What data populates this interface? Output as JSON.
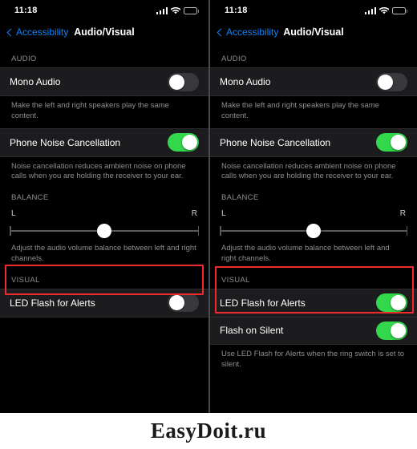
{
  "watermark": {
    "text": "EasyDoit.ru"
  },
  "colors": {
    "accent_blue": "#0a84ff",
    "toggle_on_green": "#32d74b",
    "highlight_red": "#ef2b2b",
    "group_bg": "#1c1c1e",
    "screen_bg": "#000000",
    "secondary_text": "#8e8e93"
  },
  "status_bar": {
    "time": "11:18",
    "icons": [
      "cellular-signal-icon",
      "wifi-icon",
      "battery-icon"
    ]
  },
  "nav": {
    "back_label": "Accessibility",
    "title": "Audio/Visual"
  },
  "sections": {
    "audio_header": "AUDIO",
    "balance_header": "BALANCE",
    "visual_header": "VISUAL"
  },
  "rows": {
    "mono_audio": "Mono Audio",
    "phone_noise_cancellation": "Phone Noise Cancellation",
    "led_flash_for_alerts": "LED Flash for Alerts",
    "flash_on_silent": "Flash on Silent"
  },
  "footnotes": {
    "mono_audio": "Make the left and right speakers play the same content.",
    "noise_cancellation": "Noise cancellation reduces ambient noise on phone calls when you are holding the receiver to your ear.",
    "balance": "Adjust the audio volume balance between left and right channels.",
    "flash_on_silent": "Use LED Flash for Alerts when the ring switch is set to silent."
  },
  "balance": {
    "left_label": "L",
    "right_label": "R",
    "value": 50
  },
  "left_screen": {
    "toggles": {
      "mono_audio": "off",
      "phone_noise_cancellation": "on",
      "led_flash_for_alerts": "off"
    },
    "visible_rows": [
      "LED Flash for Alerts"
    ]
  },
  "right_screen": {
    "toggles": {
      "mono_audio": "off",
      "phone_noise_cancellation": "on",
      "led_flash_for_alerts": "on",
      "flash_on_silent": "on"
    },
    "visible_rows": [
      "LED Flash for Alerts",
      "Flash on Silent"
    ]
  }
}
